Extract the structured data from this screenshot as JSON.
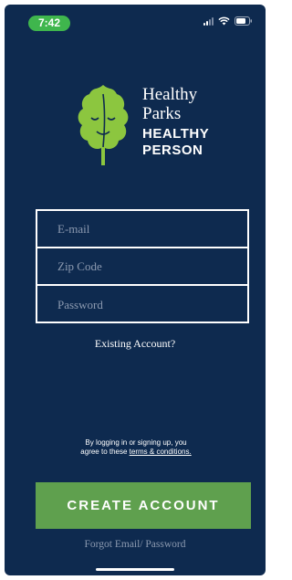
{
  "status_bar": {
    "time": "7:42",
    "icons": [
      "signal-icon",
      "wifi-icon",
      "battery-icon"
    ]
  },
  "logo": {
    "line1": "Healthy",
    "line2": "Parks",
    "line3": "HEALTHY",
    "line4": "PERSON",
    "icon": "leaf-face-icon"
  },
  "form": {
    "email_placeholder": "E-mail",
    "zip_placeholder": "Zip Code",
    "password_placeholder": "Password"
  },
  "existing_account_link": "Existing Account?",
  "legal": {
    "text": "By logging in or signing up, you agree to these ",
    "link": "terms & conditions."
  },
  "create_account_button": "CREATE ACCOUNT",
  "forgot_link": "Forgot Email/ Password",
  "colors": {
    "background": "#0e2a4f",
    "accent_green": "#5fa04e",
    "status_green": "#3fb64d",
    "leaf_green": "#8cc63f",
    "muted_text": "#8c9ab0"
  }
}
